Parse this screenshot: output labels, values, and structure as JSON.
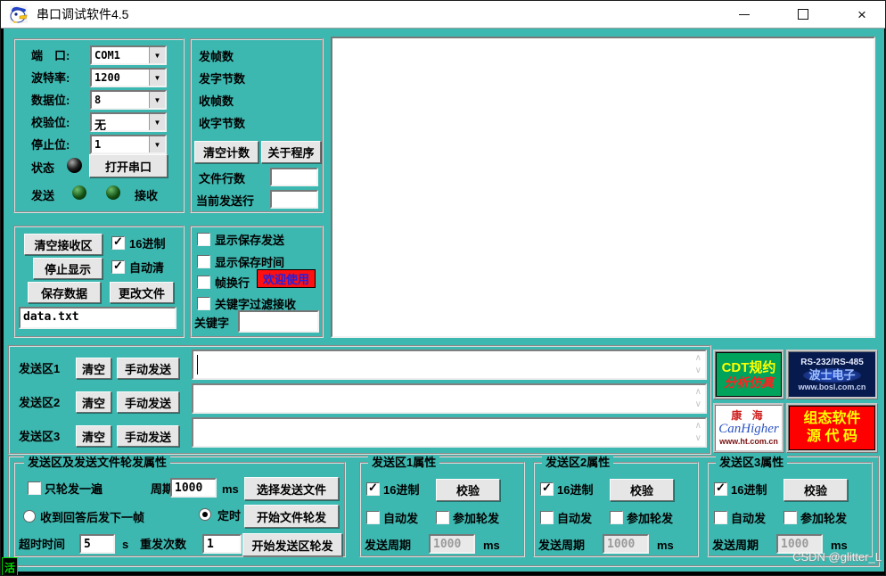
{
  "window": {
    "title": "串口调试软件4.5",
    "watermark": "CSDN @glitter_L",
    "ime_indicator": "活"
  },
  "colors": {
    "background": "#3CB8B0",
    "banner_bg": "#FF1010",
    "banner_text": "#2222DD",
    "led_status_off": "#000000",
    "led_txrx": "#1E5C1E"
  },
  "port_panel": {
    "port_label": "端　口:",
    "port_value": "COM1",
    "baud_label": "波特率:",
    "baud_value": "1200",
    "databits_label": "数据位:",
    "databits_value": "8",
    "parity_label": "校验位:",
    "parity_value": "无",
    "stopbits_label": "停止位:",
    "stopbits_value": "1",
    "status_label": "状态",
    "open_button": "打开串口",
    "tx_label": "发送",
    "rx_label": "接收"
  },
  "counter_panel": {
    "sent_frames_label": "发帧数",
    "sent_bytes_label": "发字节数",
    "recv_frames_label": "收帧数",
    "recv_bytes_label": "收字节数",
    "clear_button": "清空计数",
    "about_button": "关于程序",
    "file_lines_label": "文件行数",
    "file_lines_value": "",
    "current_line_label": "当前发送行",
    "current_line_value": ""
  },
  "receive_panel": {
    "clear_button": "清空接收区",
    "hex_label": "16进制",
    "stop_button": "停止显示",
    "autoclear_label": "自动清",
    "save_button": "保存数据",
    "change_button": "更改文件",
    "filename": "data.txt"
  },
  "display_panel": {
    "cb_show_send": "显示保存发送",
    "cb_show_time": "显示保存时间",
    "cb_frame_newline": "帧换行",
    "banner": "欢迎使用",
    "cb_keyword_filter": "关键字过滤接收",
    "keyword_label": "关键字",
    "keyword_value": ""
  },
  "receive_area": {
    "content": ""
  },
  "send_area": {
    "rows": [
      {
        "label": "发送区1",
        "clear_button": "清空",
        "send_button": "手动发送",
        "value": ""
      },
      {
        "label": "发送区2",
        "clear_button": "清空",
        "send_button": "手动发送",
        "value": ""
      },
      {
        "label": "发送区3",
        "clear_button": "清空",
        "send_button": "手动发送",
        "value": ""
      }
    ]
  },
  "logos": {
    "cdt": {
      "line1": "CDT规约",
      "line2": "分析仿真"
    },
    "bosi": {
      "line1": "RS-232/RS-485",
      "line2": "波士电子",
      "line3": "www.bosl.com.cn"
    },
    "canhigher": {
      "line1": "康 海",
      "line2": "CanHigher",
      "line3": "www.ht.com.cn"
    },
    "zutai": {
      "line1": "组态软件",
      "line2": "源 代 码"
    }
  },
  "poll_group": {
    "title": "发送区及发送文件轮发属性",
    "once_checkbox": "只轮发一遍",
    "period_label": "周期",
    "period_value": "1000",
    "period_unit": "ms",
    "radio_answer": "收到回答后发下一帧",
    "radio_timer": "定时",
    "timeout_label": "超时时间",
    "timeout_value": "5",
    "timeout_unit": "s",
    "retry_label": "重发次数",
    "retry_value": "1",
    "select_file_button": "选择发送文件",
    "start_file_button": "开始文件轮发",
    "start_area_button": "开始发送区轮发"
  },
  "send_prop_groups": [
    {
      "title": "发送区1属性",
      "hex_label": "16进制",
      "verify_button": "校验",
      "auto_label": "自动发",
      "join_label": "参加轮发",
      "period_label": "发送周期",
      "period_value": "1000",
      "unit": "ms"
    },
    {
      "title": "发送区2属性",
      "hex_label": "16进制",
      "verify_button": "校验",
      "auto_label": "自动发",
      "join_label": "参加轮发",
      "period_label": "发送周期",
      "period_value": "1000",
      "unit": "ms"
    },
    {
      "title": "发送区3属性",
      "hex_label": "16进制",
      "verify_button": "校验",
      "auto_label": "自动发",
      "join_label": "参加轮发",
      "period_label": "发送周期",
      "period_value": "1000",
      "unit": "ms"
    }
  ]
}
